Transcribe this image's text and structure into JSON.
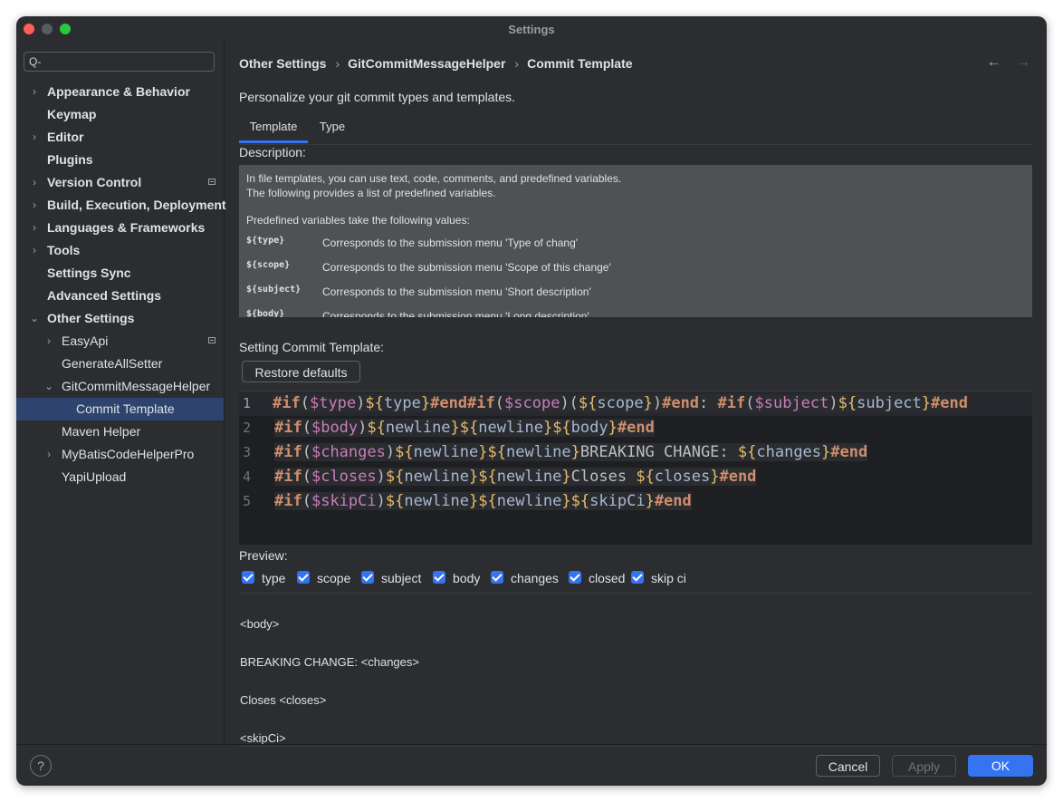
{
  "window": {
    "title": "Settings"
  },
  "search": {
    "value": "",
    "glyph": "Q-"
  },
  "sidebar": {
    "items": [
      {
        "label": "Appearance & Behavior",
        "arrow": "›",
        "level": 0,
        "bold": true
      },
      {
        "label": "Keymap",
        "arrow": "",
        "level": 0,
        "bold": true
      },
      {
        "label": "Editor",
        "arrow": "›",
        "level": 0,
        "bold": true
      },
      {
        "label": "Plugins",
        "arrow": "",
        "level": 0,
        "bold": true
      },
      {
        "label": "Version Control",
        "arrow": "›",
        "level": 0,
        "bold": true,
        "modified": true
      },
      {
        "label": "Build, Execution, Deployment",
        "arrow": "›",
        "level": 0,
        "bold": true
      },
      {
        "label": "Languages & Frameworks",
        "arrow": "›",
        "level": 0,
        "bold": true
      },
      {
        "label": "Tools",
        "arrow": "›",
        "level": 0,
        "bold": true
      },
      {
        "label": "Settings Sync",
        "arrow": "",
        "level": 0,
        "bold": true
      },
      {
        "label": "Advanced Settings",
        "arrow": "",
        "level": 0,
        "bold": true
      },
      {
        "label": "Other Settings",
        "arrow": "⌄",
        "level": 0,
        "bold": true
      },
      {
        "label": "EasyApi",
        "arrow": "›",
        "level": 1,
        "bold": false,
        "modified": true
      },
      {
        "label": "GenerateAllSetter",
        "arrow": "",
        "level": 1,
        "bold": false
      },
      {
        "label": "GitCommitMessageHelper",
        "arrow": "⌄",
        "level": 1,
        "bold": false
      },
      {
        "label": "Commit Template",
        "arrow": "",
        "level": 2,
        "bold": false,
        "selected": true
      },
      {
        "label": "Maven Helper",
        "arrow": "",
        "level": 1,
        "bold": false
      },
      {
        "label": "MyBatisCodeHelperPro",
        "arrow": "›",
        "level": 1,
        "bold": false
      },
      {
        "label": "YapiUpload",
        "arrow": "",
        "level": 1,
        "bold": false
      }
    ]
  },
  "breadcrumb": {
    "items": [
      "Other Settings",
      "GitCommitMessageHelper",
      "Commit Template"
    ],
    "separator": "›"
  },
  "nav": {
    "back": "←",
    "forward": "→"
  },
  "subtitle": "Personalize your git commit types and templates.",
  "tabs": [
    "Template",
    "Type"
  ],
  "description": {
    "label": "Description:",
    "intro": [
      "In file templates, you can use text, code, comments, and predefined variables.",
      "The following provides a list of predefined variables."
    ],
    "vars_heading": "Predefined variables take the following values:",
    "vars": [
      {
        "name": "${type}",
        "desc": "Corresponds to the submission menu 'Type of chang'"
      },
      {
        "name": "${scope}",
        "desc": "Corresponds to the submission menu 'Scope of this change'"
      },
      {
        "name": "${subject}",
        "desc": "Corresponds to the submission menu 'Short description'"
      },
      {
        "name": "${body}",
        "desc": "Corresponds to the submission menu 'Long description'"
      }
    ]
  },
  "template_section": {
    "label": "Setting Commit Template:",
    "restore_label": "Restore defaults"
  },
  "editor": {
    "line_numbers": [
      "1",
      "2",
      "3",
      "4",
      "5"
    ],
    "lines": [
      "#if($type)${type}#end#if($scope)(${scope})#end: #if($subject)${subject}#end",
      "#if($body)${newline}${newline}${body}#end",
      "#if($changes)${newline}${newline}BREAKING CHANGE: ${changes}#end",
      "#if($closes)${newline}${newline}Closes ${closes}#end",
      "#if($skipCi)${newline}${newline}${skipCi}#end"
    ]
  },
  "preview": {
    "label": "Preview:",
    "checkboxes": [
      {
        "label": "type",
        "checked": true
      },
      {
        "label": "scope",
        "checked": true
      },
      {
        "label": "subject",
        "checked": true
      },
      {
        "label": "body",
        "checked": true
      },
      {
        "label": "changes",
        "checked": true
      },
      {
        "label": "closed",
        "checked": true
      },
      {
        "label": "skip ci",
        "checked": true
      }
    ],
    "lines": [
      "<body>",
      "BREAKING CHANGE: <changes>",
      "Closes <closes>",
      "<skipCi>"
    ]
  },
  "footer": {
    "help": "?",
    "cancel": "Cancel",
    "apply": "Apply",
    "ok": "OK"
  },
  "colors": {
    "accent": "#3574f0",
    "background": "#2b2d30",
    "editor_bg": "#1e1f22",
    "selection": "#2e436e"
  }
}
